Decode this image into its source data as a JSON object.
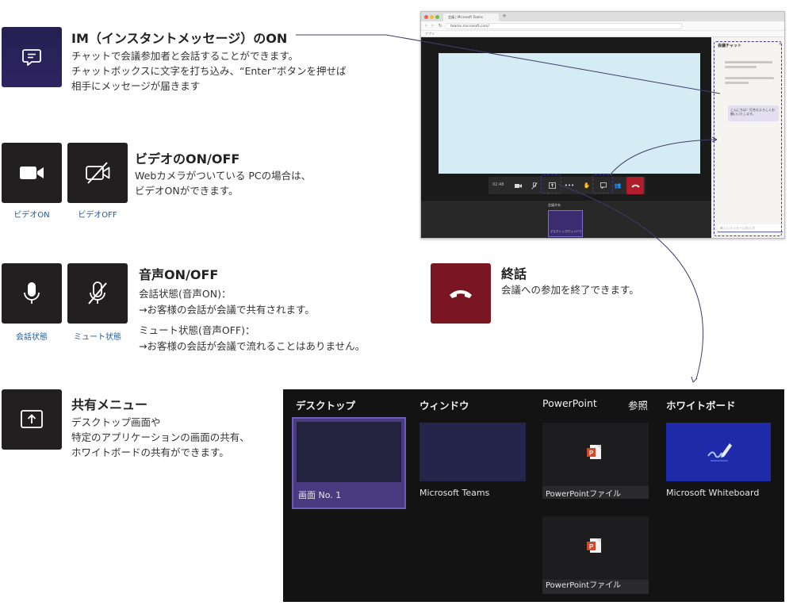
{
  "sections": {
    "im": {
      "title": "IM（インスタントメッセージ）のON",
      "lines": [
        "チャットで会議参加者と会話することができます。",
        "チャットボックスに文字を打ち込み、“Enter”ボタンを押せば",
        "相手にメッセージが届きます"
      ],
      "icon": "chat-icon"
    },
    "video": {
      "title": "ビデオのON/OFF",
      "lines": [
        "Webカメラがついている PCの場合は、",
        "ビデオONができます。"
      ],
      "tile_on_caption": "ビデオON",
      "tile_off_caption": "ビデオOFF"
    },
    "audio": {
      "title": "音声ON/OFF",
      "lines": [
        "会話状態(音声ON)：",
        "→お客様の会話が会議で共有されます。",
        "ミュート状態(音声OFF)：",
        "→お客様の会話が会議で流れることはありません。"
      ],
      "tile_on_caption": "会話状態",
      "tile_off_caption": "ミュート状態"
    },
    "hangup": {
      "title": "終話",
      "lines": [
        "会議への参加を終了できます。"
      ]
    },
    "share": {
      "title": "共有メニュー",
      "lines": [
        "デスクトップ画面や",
        "特定のアプリケーションの画面の共有、",
        "ホワイトボードの共有ができます。"
      ]
    }
  },
  "browser": {
    "tab_title": "会議 | Microsoft Teams",
    "new_tab": "+",
    "url": "teams.microsoft.com/",
    "bookmarks": "アプリ",
    "timer": "02:48",
    "chat_title": "会議チャット",
    "chat_bubble": "こんにちは！打合せよろしくお願いいたします。",
    "chat_input_placeholder": "新しいメッセージの入力",
    "share_label": "会議共有",
    "share_thumb_label": "デスクトップ/ウィンドウ"
  },
  "share_panel": {
    "columns": {
      "desktop": "デスクトップ",
      "window": "ウィンドウ",
      "powerpoint": "PowerPoint",
      "browse": "参照",
      "whiteboard": "ホワイトボード"
    },
    "items": {
      "screen1": "画面 No. 1",
      "teams": "Microsoft Teams",
      "ppt1": "PowerPointファイル",
      "ppt2": "PowerPointファイル",
      "whiteboard": "Microsoft Whiteboard"
    }
  },
  "colors": {
    "tile_dark": "#221f20",
    "tile_purple": "#2b2357",
    "tile_red": "#7a1522",
    "caption_blue": "#1f5a96",
    "teams_purple": "#6264a7",
    "highlight": "#5a4a94"
  }
}
